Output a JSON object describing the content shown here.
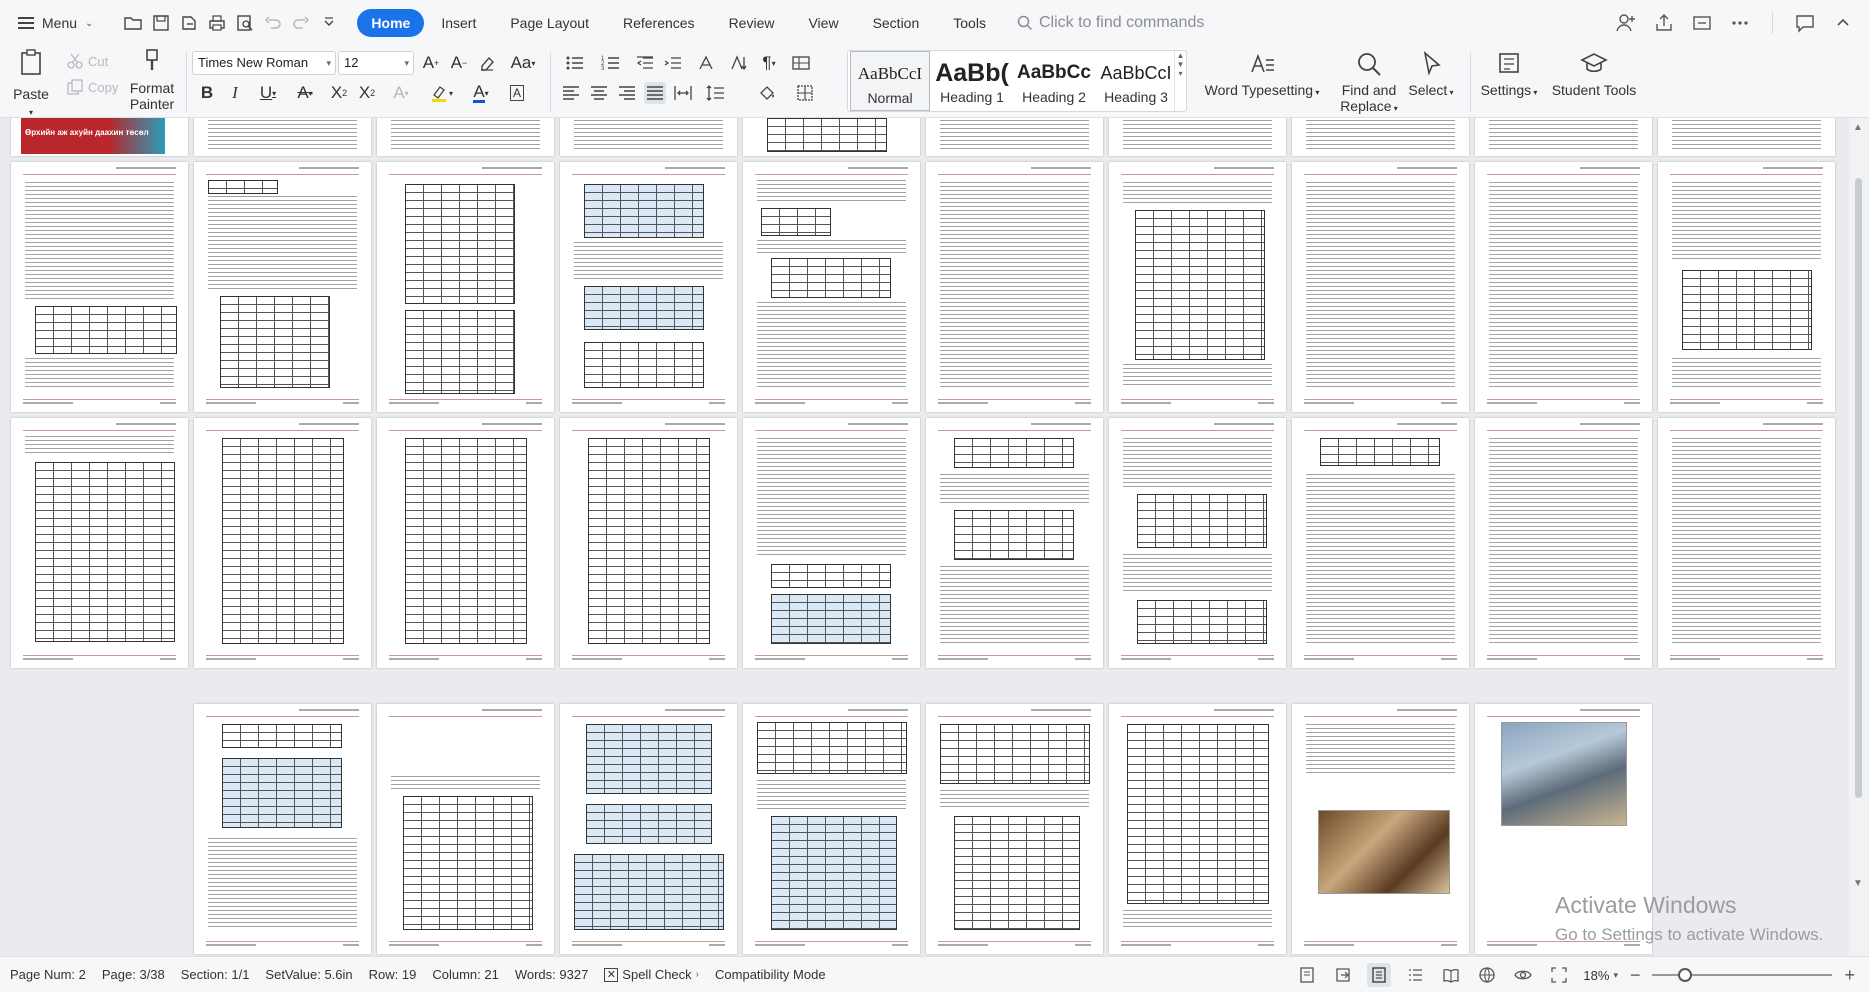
{
  "menubar": {
    "menu_label": "Menu",
    "tabs": [
      "Home",
      "Insert",
      "Page Layout",
      "References",
      "Review",
      "View",
      "Section",
      "Tools"
    ],
    "active_tab": "Home",
    "search_placeholder": "Click to find commands"
  },
  "ribbon": {
    "paste": "Paste",
    "cut": "Cut",
    "copy": "Copy",
    "format_painter_line1": "Format",
    "format_painter_line2": "Painter",
    "font_name": "Times New Roman",
    "font_size": "12",
    "styles": [
      {
        "preview": "AaBbCcI",
        "name": "Normal"
      },
      {
        "preview": "AaBb(",
        "name": "Heading 1"
      },
      {
        "preview": "AaBbCc",
        "name": "Heading 2"
      },
      {
        "preview": "AaBbCcI",
        "name": "Heading 3"
      }
    ],
    "word_typesetting": "Word Typesetting",
    "find_replace_line1": "Find and",
    "find_replace_line2": "Replace",
    "select": "Select",
    "settings": "Settings",
    "student_tools": "Student Tools"
  },
  "document": {
    "cover_text": "Өрхийн аж ахуйн даахин төсөл"
  },
  "watermark": {
    "title": "Activate Windows",
    "subtitle": "Go to Settings to activate Windows."
  },
  "statusbar": {
    "page_num": "Page Num: 2",
    "page": "Page: 3/38",
    "section": "Section: 1/1",
    "setvalue": "SetValue: 5.6in",
    "row": "Row: 19",
    "column": "Column: 21",
    "words": "Words: 9327",
    "spell_check": "Spell Check",
    "compat_mode": "Compatibility Mode",
    "zoom": "18%",
    "zoom_level": 0.18
  }
}
